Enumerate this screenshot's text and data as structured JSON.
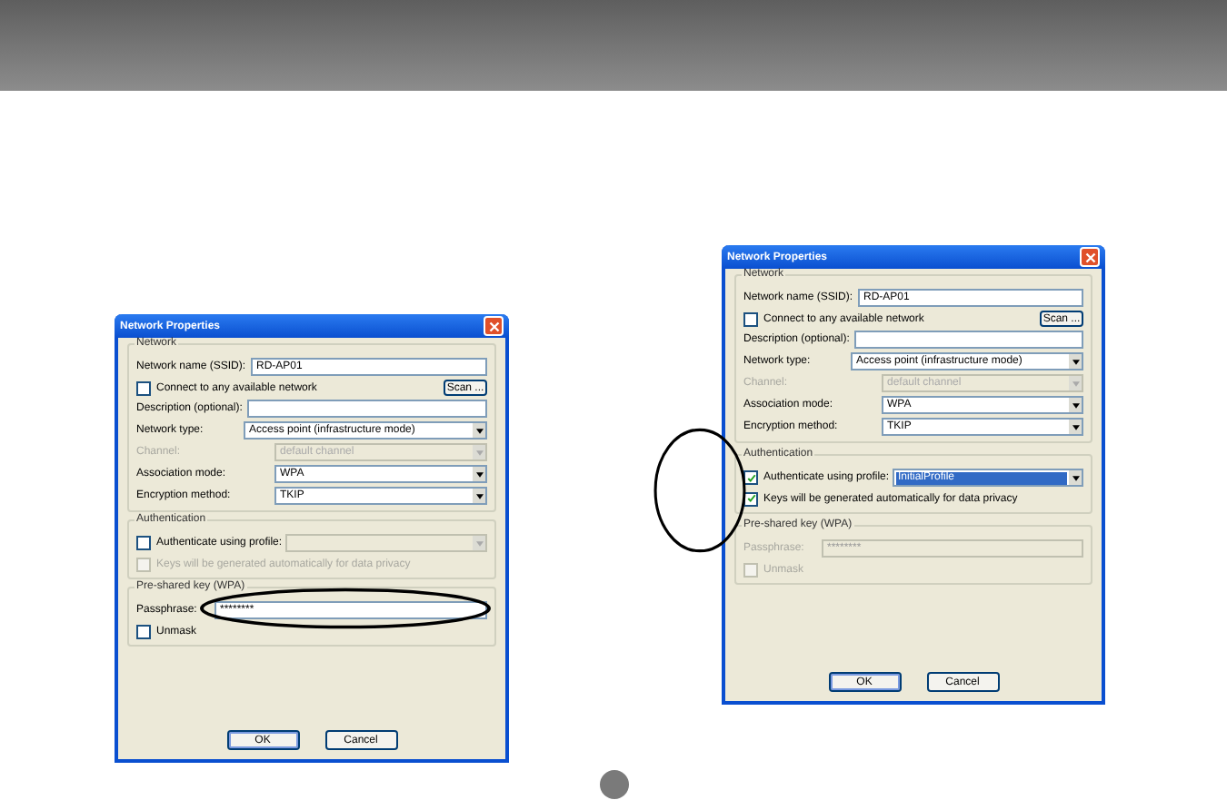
{
  "dialogs": [
    {
      "title": "Network Properties",
      "network": {
        "legend": "Network",
        "ssid_label": "Network name (SSID):",
        "ssid": "RD-AP01",
        "connect_label": "Connect to any available network",
        "connect_checked": false,
        "scan": "Scan ...",
        "desc_label": "Description (optional):",
        "combos": [
          {
            "label": "Network type:",
            "value": "Access point (infrastructure mode)",
            "disabled": false,
            "wide": true
          },
          {
            "label": "Channel:",
            "value": "default channel",
            "disabled": true,
            "wide": false
          },
          {
            "label": "Association mode:",
            "value": "WPA",
            "disabled": false,
            "wide": false
          },
          {
            "label": "Encryption method:",
            "value": "TKIP",
            "disabled": false,
            "wide": false
          }
        ]
      },
      "auth": {
        "legend": "Authentication",
        "profile_label": "Authenticate using profile:",
        "profile_checked": false,
        "profile_disabled": false,
        "profile_combo_disabled": true,
        "keys_label": "Keys will be generated automatically for data privacy",
        "keys_checked": false,
        "keys_disabled": true
      },
      "psk": {
        "legend": "Pre-shared key (WPA)",
        "disabled": false,
        "pass_label": "Passphrase:",
        "pass_value": "********",
        "unmask_label": "Unmask",
        "unmask_checked": false
      },
      "buttons": [
        "OK",
        "Cancel"
      ],
      "callout": {
        "kind": "passphrase"
      }
    },
    {
      "title": "Network Properties",
      "network": {
        "legend": "Network",
        "ssid_label": "Network name (SSID):",
        "ssid": "RD-AP01",
        "connect_label": "Connect to any available network",
        "connect_checked": false,
        "scan": "Scan ...",
        "desc_label": "Description (optional):",
        "combos": [
          {
            "label": "Network type:",
            "value": "Access point (infrastructure mode)",
            "disabled": false,
            "wide": true
          },
          {
            "label": "Channel:",
            "value": "default channel",
            "disabled": true,
            "wide": false
          },
          {
            "label": "Association mode:",
            "value": "WPA",
            "disabled": false,
            "wide": false
          },
          {
            "label": "Encryption method:",
            "value": "TKIP",
            "disabled": false,
            "wide": false
          }
        ]
      },
      "auth": {
        "legend": "Authentication",
        "profile_label": "Authenticate using profile:",
        "profile_checked": true,
        "profile_disabled": false,
        "profile_combo_disabled": false,
        "profile_value": "InitialProfile",
        "keys_label": "Keys will be generated automatically for data privacy",
        "keys_checked": true,
        "keys_disabled": false
      },
      "psk": {
        "legend": "Pre-shared key (WPA)",
        "disabled": true,
        "pass_label": "Passphrase:",
        "pass_value": "********",
        "unmask_label": "Unmask",
        "unmask_checked": false
      },
      "buttons": [
        "OK",
        "Cancel"
      ],
      "callout": {
        "kind": "auth"
      }
    }
  ]
}
